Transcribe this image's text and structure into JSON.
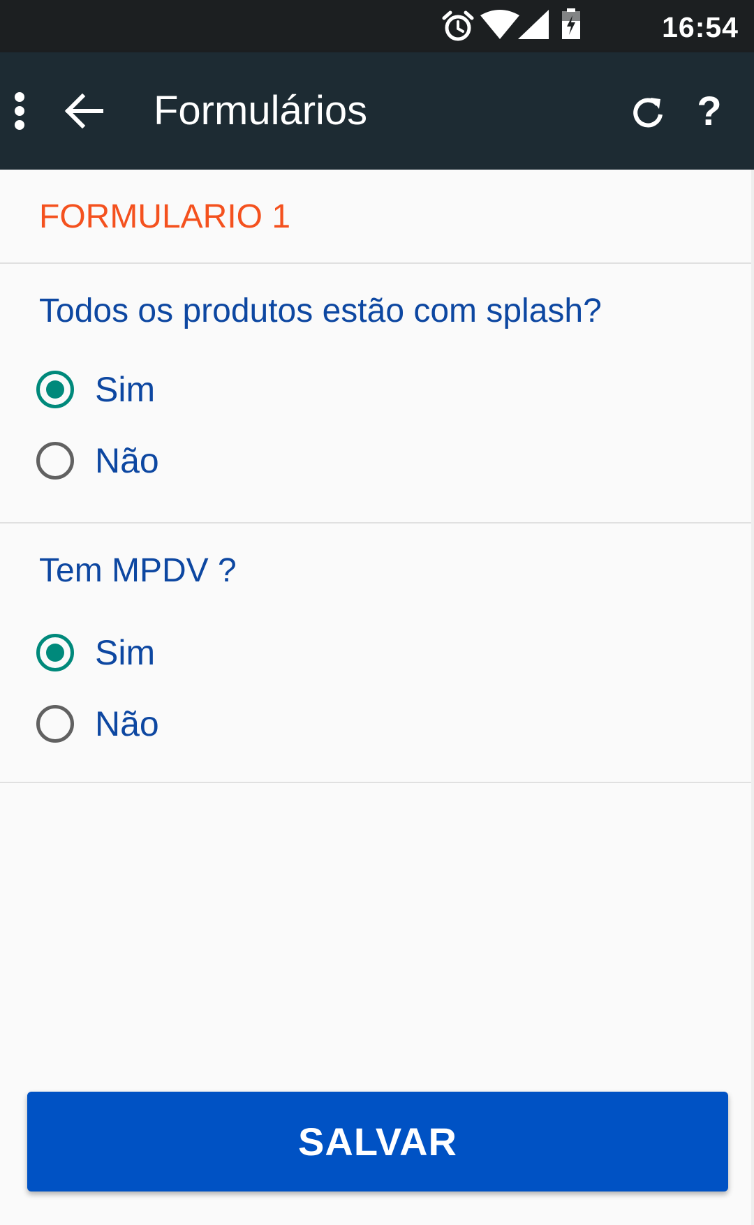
{
  "status_bar": {
    "time": "16:54",
    "icons": [
      "alarm-icon",
      "wifi-icon",
      "cell-signal-icon",
      "battery-charging-icon"
    ]
  },
  "toolbar": {
    "title": "Formulários",
    "icons": [
      "overflow-menu-icon",
      "back-arrow-icon",
      "refresh-icon",
      "help-icon"
    ],
    "help_label": "?"
  },
  "form": {
    "title": "FORMULARIO 1",
    "questions": [
      {
        "text": "Todos os produtos estão com splash?",
        "options": [
          {
            "label": "Sim",
            "selected": true
          },
          {
            "label": "Não",
            "selected": false
          }
        ]
      },
      {
        "text": "Tem MPDV  ?",
        "options": [
          {
            "label": "Sim",
            "selected": true
          },
          {
            "label": "Não",
            "selected": false
          }
        ]
      }
    ]
  },
  "save_button": {
    "label": "SALVAR"
  },
  "colors": {
    "status_bar": "#1c1f21",
    "toolbar": "#1d2b33",
    "form_title": "#f4511e",
    "question_text": "#0d47a1",
    "radio_checked": "#00897b",
    "button": "#0052c4"
  }
}
